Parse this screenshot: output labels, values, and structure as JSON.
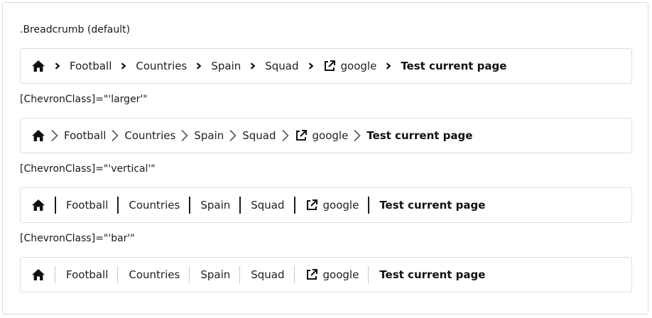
{
  "sections": [
    {
      "label": ".Breadcrumb (default)",
      "variant": "default",
      "items": [
        {
          "label": "Football"
        },
        {
          "label": "Countries"
        },
        {
          "label": "Spain"
        },
        {
          "label": "Squad"
        },
        {
          "label": "google",
          "icon": "external-link-icon"
        },
        {
          "label": "Test current page",
          "current": true
        }
      ]
    },
    {
      "label": "[ChevronClass]=\"'larger'\"",
      "variant": "larger",
      "items": [
        {
          "label": "Football"
        },
        {
          "label": "Countries"
        },
        {
          "label": "Spain"
        },
        {
          "label": "Squad"
        },
        {
          "label": "google",
          "icon": "external-link-icon"
        },
        {
          "label": "Test current page",
          "current": true
        }
      ]
    },
    {
      "label": "[ChevronClass]=\"'vertical'\"",
      "variant": "vertical",
      "items": [
        {
          "label": "Football"
        },
        {
          "label": "Countries"
        },
        {
          "label": "Spain"
        },
        {
          "label": "Squad"
        },
        {
          "label": "google",
          "icon": "external-link-icon"
        },
        {
          "label": "Test current page",
          "current": true
        }
      ]
    },
    {
      "label": "[ChevronClass]=\"'bar'\"",
      "variant": "bar",
      "items": [
        {
          "label": "Football"
        },
        {
          "label": "Countries"
        },
        {
          "label": "Spain"
        },
        {
          "label": "Squad"
        },
        {
          "label": "google",
          "icon": "external-link-icon"
        },
        {
          "label": "Test current page",
          "current": true
        }
      ]
    }
  ],
  "icons": {
    "home": "home-icon",
    "external": "external-link-icon"
  }
}
